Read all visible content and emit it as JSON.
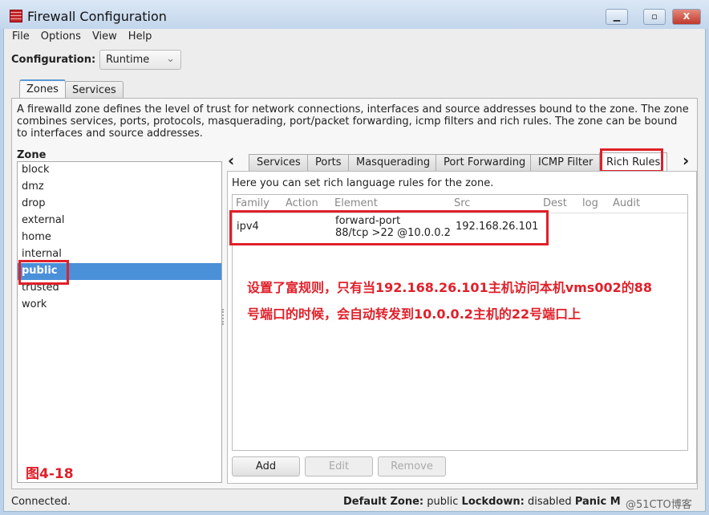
{
  "window": {
    "title": "Firewall Configuration",
    "minimize": "▁",
    "maximize": "▫",
    "close": "X"
  },
  "menu": [
    "File",
    "Options",
    "View",
    "Help"
  ],
  "configuration": {
    "label": "Configuration:",
    "value": "Runtime"
  },
  "main_tabs": [
    "Zones",
    "Services"
  ],
  "description": "A firewalld zone defines the level of trust for network connections, interfaces and source addresses bound to the zone. The zone combines services, ports, protocols, masquerading, port/packet forwarding, icmp filters and rich rules. The zone can be bound to interfaces and source addresses.",
  "zone": {
    "label": "Zone",
    "items": [
      "block",
      "dmz",
      "drop",
      "external",
      "home",
      "internal",
      "public",
      "trusted",
      "work"
    ],
    "selected": "public"
  },
  "sub_tabs": [
    "Services",
    "Ports",
    "Masquerading",
    "Port Forwarding",
    "ICMP Filter",
    "Rich Rules"
  ],
  "rich_rules": {
    "intro": "Here you can set rich language rules for the zone.",
    "columns": [
      "Family",
      "Action",
      "Element",
      "Src",
      "Dest",
      "log",
      "Audit"
    ],
    "rows": [
      {
        "family": "ipv4",
        "action": "",
        "element_line1": "forward-port",
        "element_line2": "88/tcp >22 @10.0.0.2",
        "src": "192.168.26.101"
      }
    ],
    "buttons": {
      "add": "Add",
      "edit": "Edit",
      "remove": "Remove"
    }
  },
  "annotation": {
    "line1": "设置了富规则，只有当192.168.26.101主机访问本机vms002的88",
    "line2": "号端口的时候，会自动转发到10.0.0.2主机的22号端口上",
    "figure": "图4-18",
    "color": "#e0202a"
  },
  "status": {
    "left": "Connected.",
    "default_zone_label": "Default Zone:",
    "default_zone": "public",
    "lockdown_label": "Lockdown:",
    "lockdown": "disabled",
    "panic_label": "Panic M",
    "watermark": "@51CTO博客"
  }
}
